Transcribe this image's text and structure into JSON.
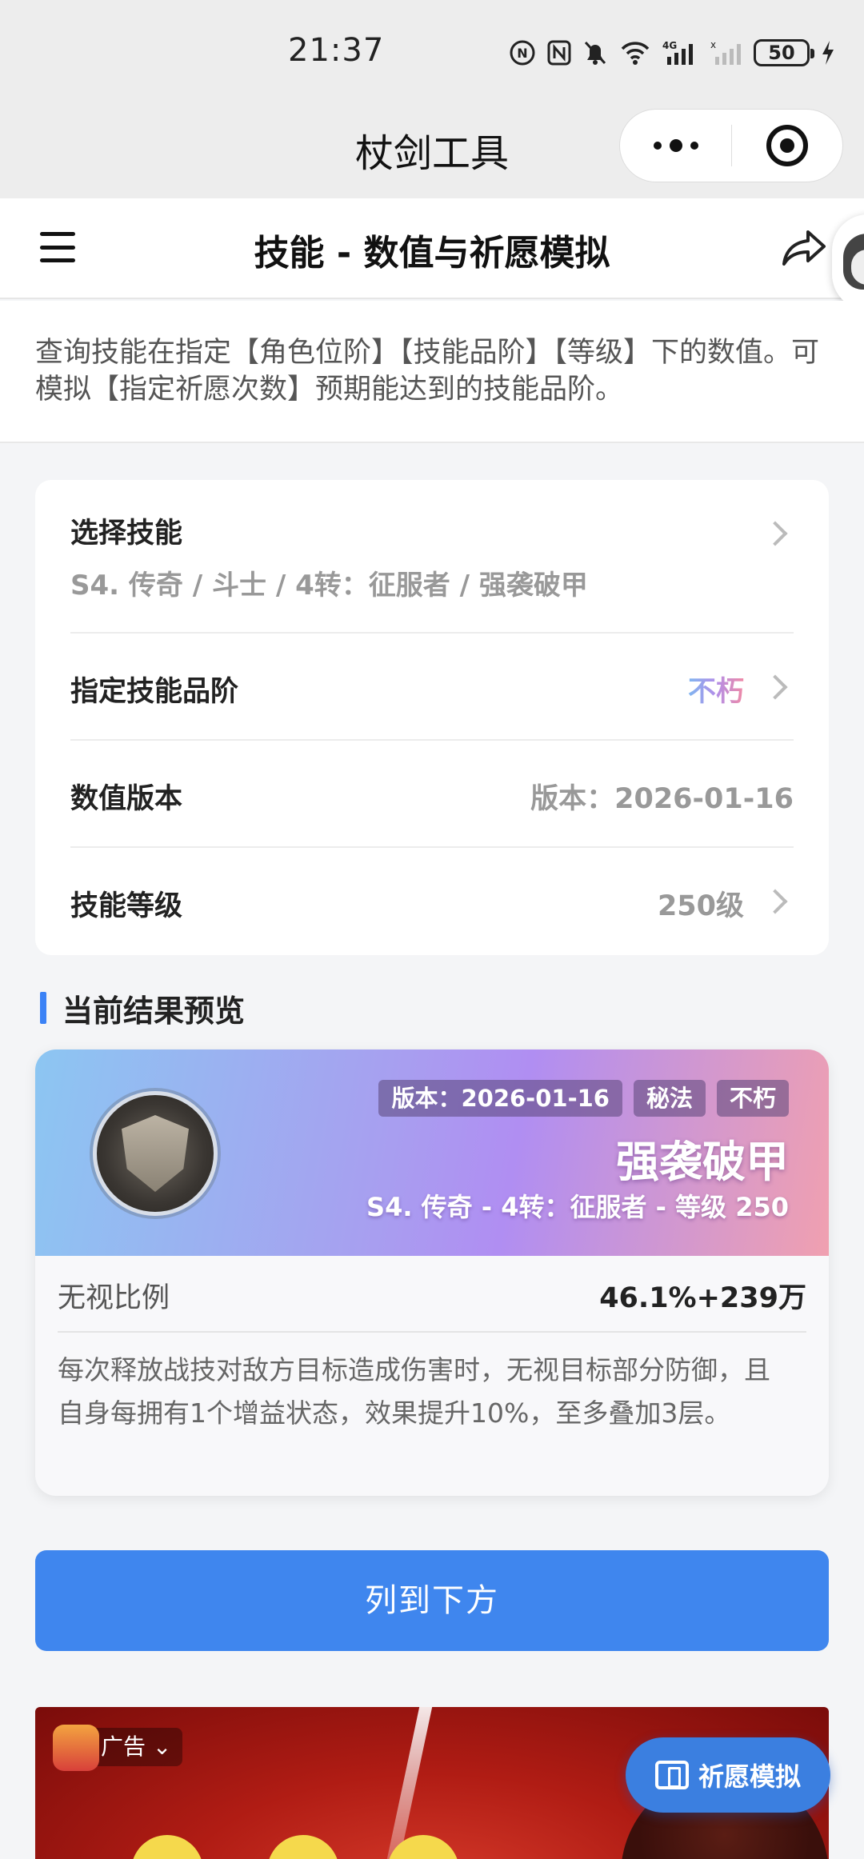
{
  "status_bar": {
    "time": "21:37",
    "battery": "50",
    "icons": [
      "nfc-icon",
      "nfc-n-icon",
      "mute-bell-icon",
      "wifi-icon",
      "signal-4g-icon",
      "signal-empty-icon",
      "charging-icon"
    ]
  },
  "mini_program": {
    "title": "杖剑工具",
    "more_icon": "more-dots-icon",
    "close_icon": "target-close-icon"
  },
  "header": {
    "title": "技能 - 数值与祈愿模拟",
    "menu_icon": "hamburger-icon",
    "share_icon": "share-icon"
  },
  "description": "查询技能在指定【角色位阶】【技能品阶】【等级】下的数值。可模拟【指定祈愿次数】预期能达到的技能品阶。",
  "settings": {
    "select_skill_label": "选择技能",
    "select_skill_value": "S4. 传奇 / 斗士 / 4转：征服者 / 强袭破甲",
    "grade_label": "指定技能品阶",
    "grade_value": "不朽",
    "version_label": "数值版本",
    "version_value": "版本：2026-01-16",
    "level_label": "技能等级",
    "level_value": "250级"
  },
  "preview": {
    "section_title": "当前结果预览",
    "tags": [
      "版本：2026-01-16",
      "秘法",
      "不朽"
    ],
    "skill_name": "强袭破甲",
    "skill_path": "S4. 传奇 - 4转：征服者 - 等级 250",
    "stat_label": "无视比例",
    "stat_value": "46.1%+239万",
    "skill_desc": "每次释放战技对敌方目标造成伤害时，无视目标部分防御，且自身每拥有1个增益状态，效果提升10%，至多叠加3层。"
  },
  "button": {
    "label": "列到下方"
  },
  "ad": {
    "label": "广告"
  },
  "float_button": {
    "label": "祈愿模拟"
  },
  "colors": {
    "accent": "#3f86ee",
    "section_bar": "#3b82f6",
    "banner_start": "#8cc6f2",
    "banner_end": "#f0a0b0"
  }
}
